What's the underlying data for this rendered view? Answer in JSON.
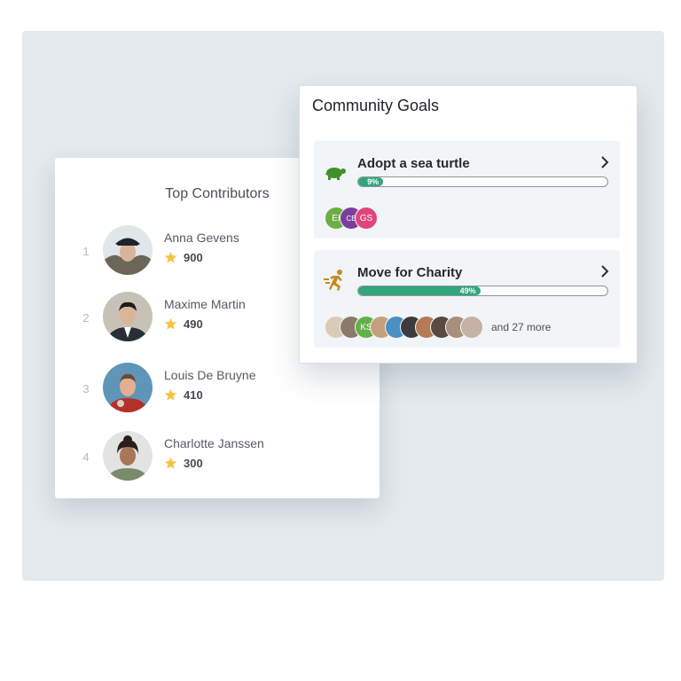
{
  "top_contributors": {
    "title": "Top Contributors",
    "rows": [
      {
        "rank": "1",
        "name": "Anna Gevens",
        "points": "900"
      },
      {
        "rank": "2",
        "name": "Maxime Martin",
        "points": "490"
      },
      {
        "rank": "3",
        "name": "Louis De Bruyne",
        "points": "410"
      },
      {
        "rank": "4",
        "name": "Charlotte Janssen",
        "points": "300"
      }
    ]
  },
  "community_goals": {
    "title": "Community Goals",
    "goals": [
      {
        "name": "Adopt a sea turtle",
        "progress_label": "9%",
        "progress": 0.09,
        "icon": "turtle-icon",
        "members": [
          {
            "initials": "EI",
            "color": "#6cae45"
          },
          {
            "initials": "CB",
            "color": "#7a3f9e"
          },
          {
            "initials": "GS",
            "color": "#e0457b"
          }
        ]
      },
      {
        "name": "Move for Charity",
        "progress_label": "49%",
        "progress": 0.49,
        "icon": "runner-icon",
        "members": [
          {
            "initials": "",
            "color": "#d9cbb7"
          },
          {
            "initials": "",
            "color": "#8b7a6a"
          },
          {
            "initials": "KS",
            "color": "#63b04a"
          },
          {
            "initials": "",
            "color": "#c5a07e"
          },
          {
            "initials": "",
            "color": "#4a90c2"
          },
          {
            "initials": "",
            "color": "#3c3c3c"
          },
          {
            "initials": "",
            "color": "#b47b56"
          },
          {
            "initials": "",
            "color": "#5a4a42"
          },
          {
            "initials": "",
            "color": "#a88f7c"
          },
          {
            "initials": "",
            "color": "#c4b2a4"
          }
        ],
        "more_text": "and 27 more"
      }
    ]
  },
  "colors": {
    "accent_green": "#2fa67b",
    "star": "#f5c342",
    "turtle": "#3f8f2a",
    "runner": "#c9891e"
  }
}
